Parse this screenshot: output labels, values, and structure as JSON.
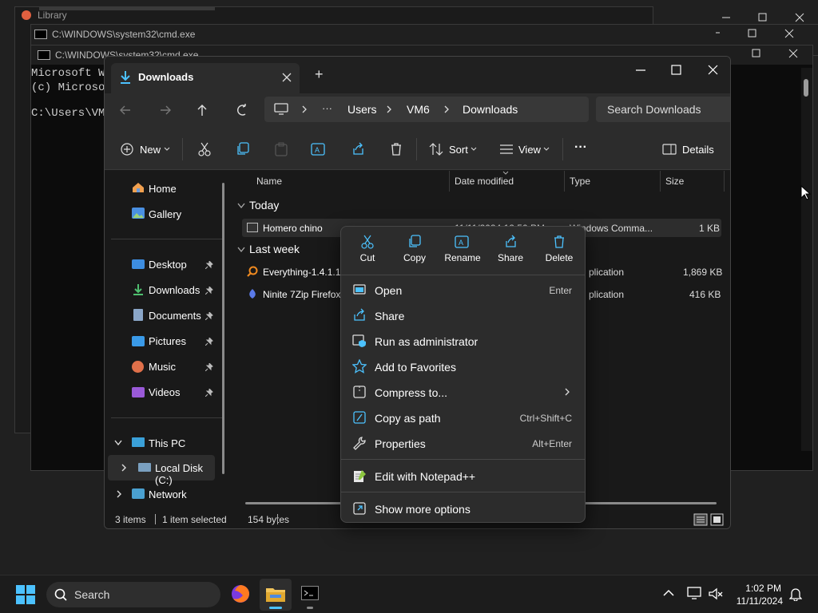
{
  "bg_window": {
    "title": "Library"
  },
  "cmd_back": {
    "title": "C:\\WINDOWS\\system32\\cmd.exe"
  },
  "cmd": {
    "title": "C:\\WINDOWS\\system32\\cmd.exe",
    "line1": "Microsoft W",
    "line2": "(c) Microso",
    "line3": "C:\\Users\\VM6"
  },
  "explorer": {
    "tab_label": "Downloads",
    "new_tab": "+",
    "breadcrumb": [
      "Users",
      "VM6",
      "Downloads"
    ],
    "ellipsis": "···",
    "search_placeholder": "Search Downloads",
    "toolbar": {
      "new": "New",
      "sort": "Sort",
      "view": "View",
      "more": "···",
      "details": "Details"
    },
    "sidebar": {
      "home": "Home",
      "gallery": "Gallery",
      "desktop": "Desktop",
      "downloads": "Downloads",
      "documents": "Documents",
      "pictures": "Pictures",
      "music": "Music",
      "videos": "Videos",
      "this_pc": "This PC",
      "local_disk": "Local Disk (C:)",
      "network": "Network"
    },
    "columns": {
      "name": "Name",
      "date": "Date modified",
      "type": "Type",
      "size": "Size"
    },
    "groups": {
      "today": "Today",
      "last_week": "Last week"
    },
    "files": [
      {
        "name": "Homero chino",
        "date": "11/11/2024 12:50 PM",
        "type": "Windows Comma...",
        "size": "1 KB"
      },
      {
        "name": "Everything-1.4.1.10",
        "date": "",
        "type": "plication",
        "size": "1,869 KB"
      },
      {
        "name": "Ninite 7Zip Firefox",
        "date": "",
        "type": "plication",
        "size": "416 KB"
      }
    ],
    "status": {
      "items": "3 items",
      "selected": "1 item selected",
      "size": "154 bytes"
    }
  },
  "context_menu": {
    "quick": {
      "cut": "Cut",
      "copy": "Copy",
      "rename": "Rename",
      "share": "Share",
      "delete": "Delete"
    },
    "open": {
      "label": "Open",
      "key": "Enter"
    },
    "share": {
      "label": "Share"
    },
    "run_admin": {
      "label": "Run as administrator"
    },
    "favorites": {
      "label": "Add to Favorites"
    },
    "compress": {
      "label": "Compress to..."
    },
    "copy_path": {
      "label": "Copy as path",
      "key": "Ctrl+Shift+C"
    },
    "properties": {
      "label": "Properties",
      "key": "Alt+Enter"
    },
    "notepad": {
      "label": "Edit with Notepad++"
    },
    "more_options": {
      "label": "Show more options"
    }
  },
  "taskbar": {
    "search": "Search",
    "time": "1:02 PM",
    "date": "11/11/2024"
  },
  "colors": {
    "accent": "#4cc2ff",
    "folder": "#f2c45a",
    "selection": "#2d2d2d"
  }
}
